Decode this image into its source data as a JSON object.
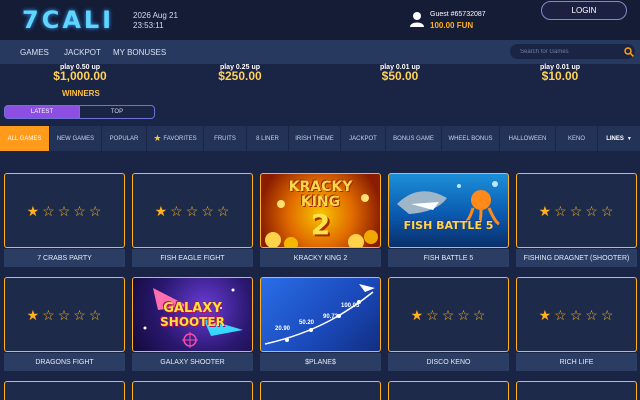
{
  "header": {
    "logo": "7CALI",
    "date": "2026 Aug 21",
    "time": "23:53:11",
    "guest": "Guest #65732087",
    "balance": "100.00 FUN",
    "login_label": "LOGIN"
  },
  "nav": {
    "items": [
      "GAMES",
      "JACKPOT",
      "MY BONUSES"
    ],
    "search_placeholder": "Search for Games"
  },
  "jackpots": [
    {
      "label": "play 0.50 up",
      "value": "$1,000.00"
    },
    {
      "label": "play 0.25 up",
      "value": "$250.00"
    },
    {
      "label": "play 0.01 up",
      "value": "$50.00"
    },
    {
      "label": "play 0.01 up",
      "value": "$10.00"
    }
  ],
  "winners": {
    "title": "WINNERS",
    "tabs": [
      "LATEST",
      "TOP"
    ]
  },
  "categories": [
    "ALL GAMES",
    "NEW GAMES",
    "POPULAR",
    "FAVORITES",
    "FRUITS",
    "8 LINER",
    "IRISH THEME",
    "JACKPOT",
    "BONUS GAME",
    "WHEEL BONUS",
    "HALLOWEEN",
    "KENO",
    "LINES"
  ],
  "games": [
    {
      "title": "7 CRABS PARTY"
    },
    {
      "title": "FISH EAGLE FIGHT"
    },
    {
      "title": "KRACKY KING 2",
      "art_line1": "KRACKY",
      "art_line2": "KING",
      "art_line3": "2"
    },
    {
      "title": "FISH BATTLE 5",
      "art_line1": "FISH BATTLE 5"
    },
    {
      "title": "FISHING DRAGNET (SHOOTER)"
    },
    {
      "title": "DRAGONS FIGHT"
    },
    {
      "title": "GALAXY SHOOTER",
      "art_line1": "GALAXY",
      "art_line2": "SHOOTER"
    },
    {
      "title": "$PLANE$",
      "art_vals": [
        "20.90",
        "50.20",
        "90.73",
        "100.05"
      ]
    },
    {
      "title": "DISCO KENO"
    },
    {
      "title": "RICH LIFE"
    }
  ],
  "colors": {
    "background": "#1a2444",
    "accent_orange": "#ff9a1a",
    "star": "#ffb21e",
    "jackpot_gold": "#ffd25a",
    "latest_purple": "#8d4ee2"
  }
}
